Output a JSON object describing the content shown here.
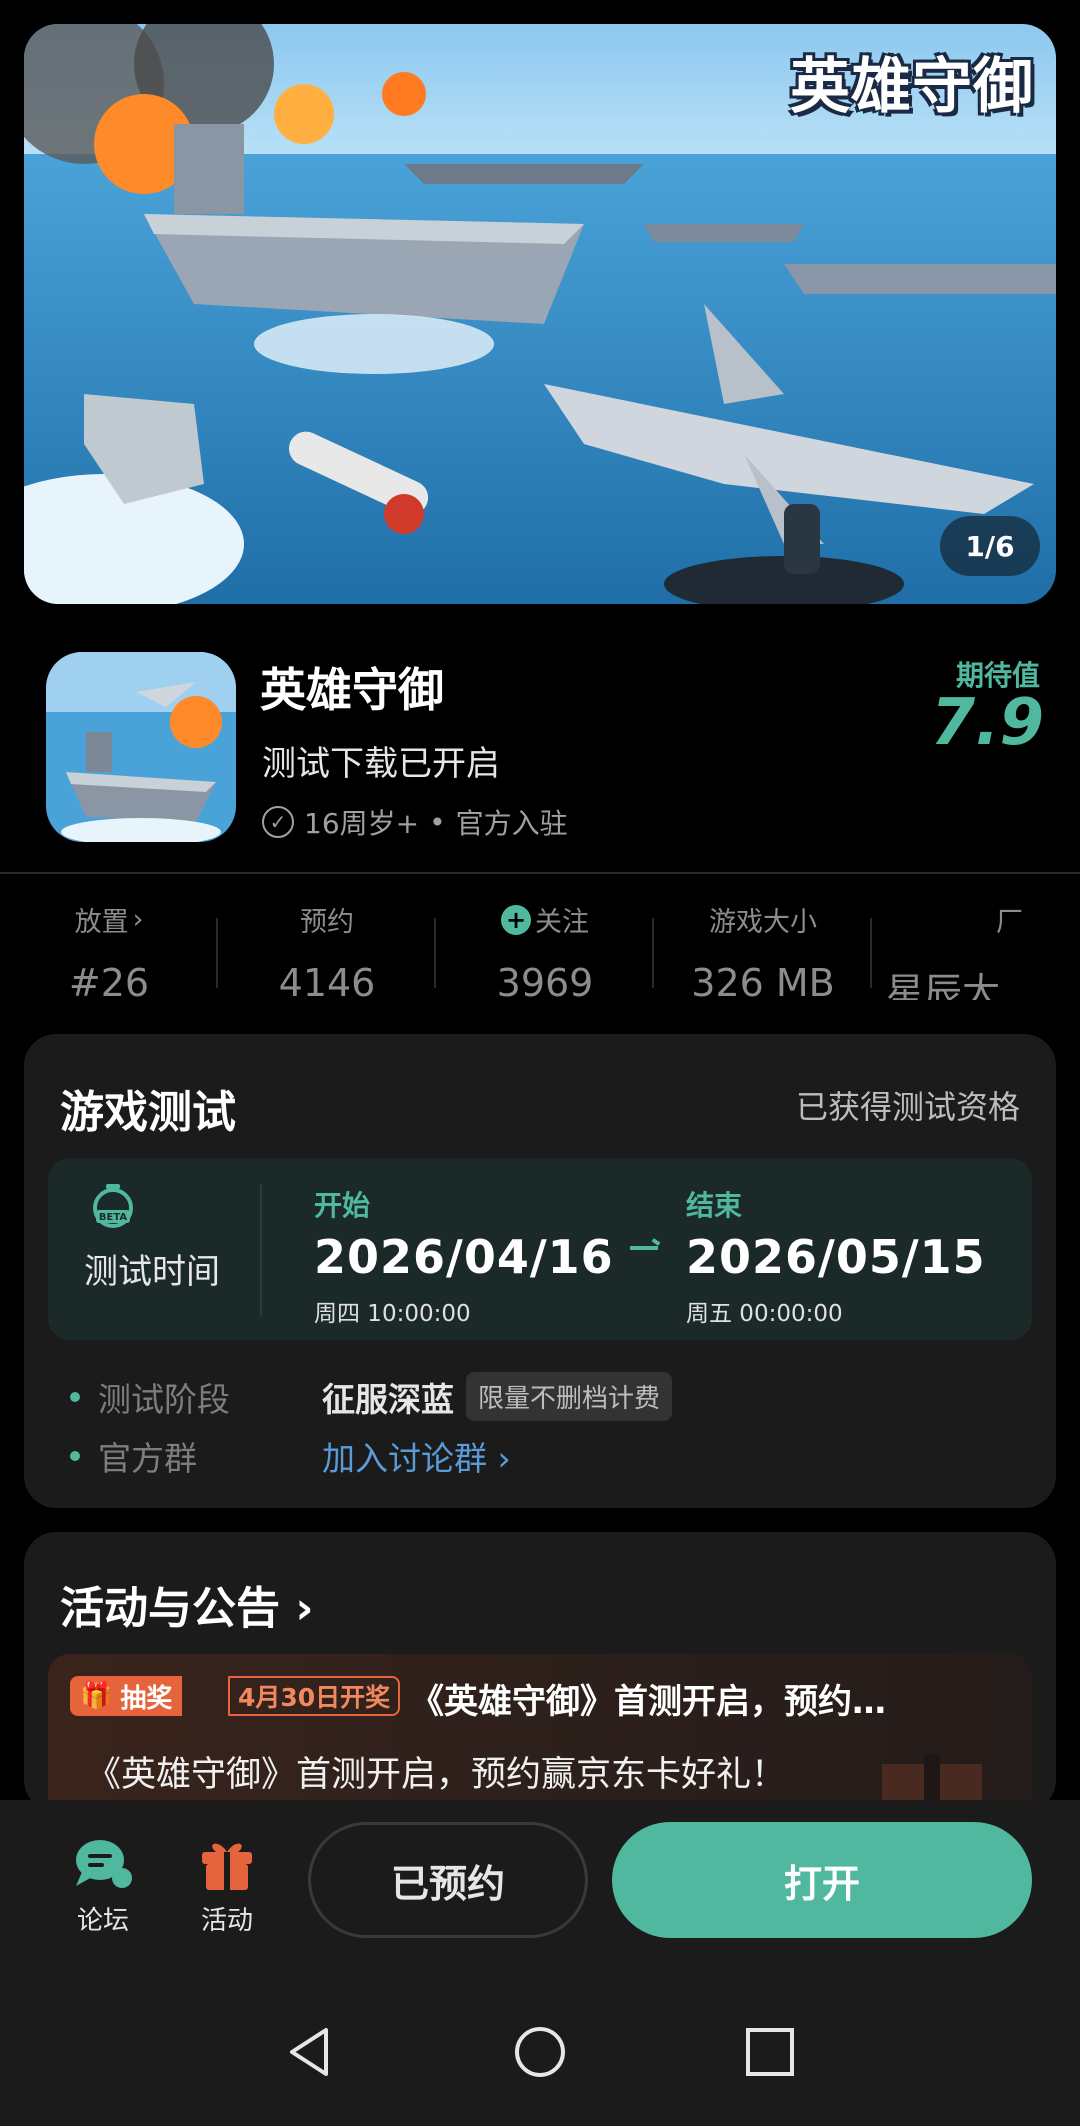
{
  "banner": {
    "title": "英雄守御",
    "page_indicator": "1/6"
  },
  "app": {
    "name": "英雄守御",
    "tagline": "测试下载已开启",
    "age_rating": "16周岁+",
    "separator": "•",
    "official": "官方入驻",
    "expect_label": "期待值",
    "expect_score": "7.9"
  },
  "stats": [
    {
      "label": "放置",
      "value": "#26",
      "chevron": "›"
    },
    {
      "label": "预约",
      "value": "4146"
    },
    {
      "label": "关注",
      "value": "3969"
    },
    {
      "label": "游戏大小",
      "value": "326 MB"
    },
    {
      "label": "厂",
      "value": "星辰大"
    }
  ],
  "test": {
    "title": "游戏测试",
    "status": "已获得测试资格",
    "time_label": "测试时间",
    "beta": "BETA",
    "start_label": "开始",
    "start_date": "2026/04/16",
    "start_sub": "周四  10:00:00",
    "end_label": "结束",
    "end_date": "2026/05/15",
    "end_sub": "周五  00:00:00",
    "phase_key": "测试阶段",
    "phase_value": "征服深蓝",
    "phase_tag": "限量不删档计费",
    "group_key": "官方群",
    "group_link": "加入讨论群 ›"
  },
  "activity": {
    "title": "活动与公告 ›",
    "badge": "抽奖",
    "badge_date": "4月30日开奖",
    "headline": "《英雄守御》首测开启，预约…",
    "body": "《英雄守御》首测开启，预约赢京东卡好礼！"
  },
  "bottom": {
    "forum_label": "论坛",
    "event_label": "活动",
    "reserved_label": "已预约",
    "open_label": "打开"
  },
  "colors": {
    "accent": "#4fb89e",
    "lottery": "#e6643c",
    "link": "#5a9bd8"
  }
}
